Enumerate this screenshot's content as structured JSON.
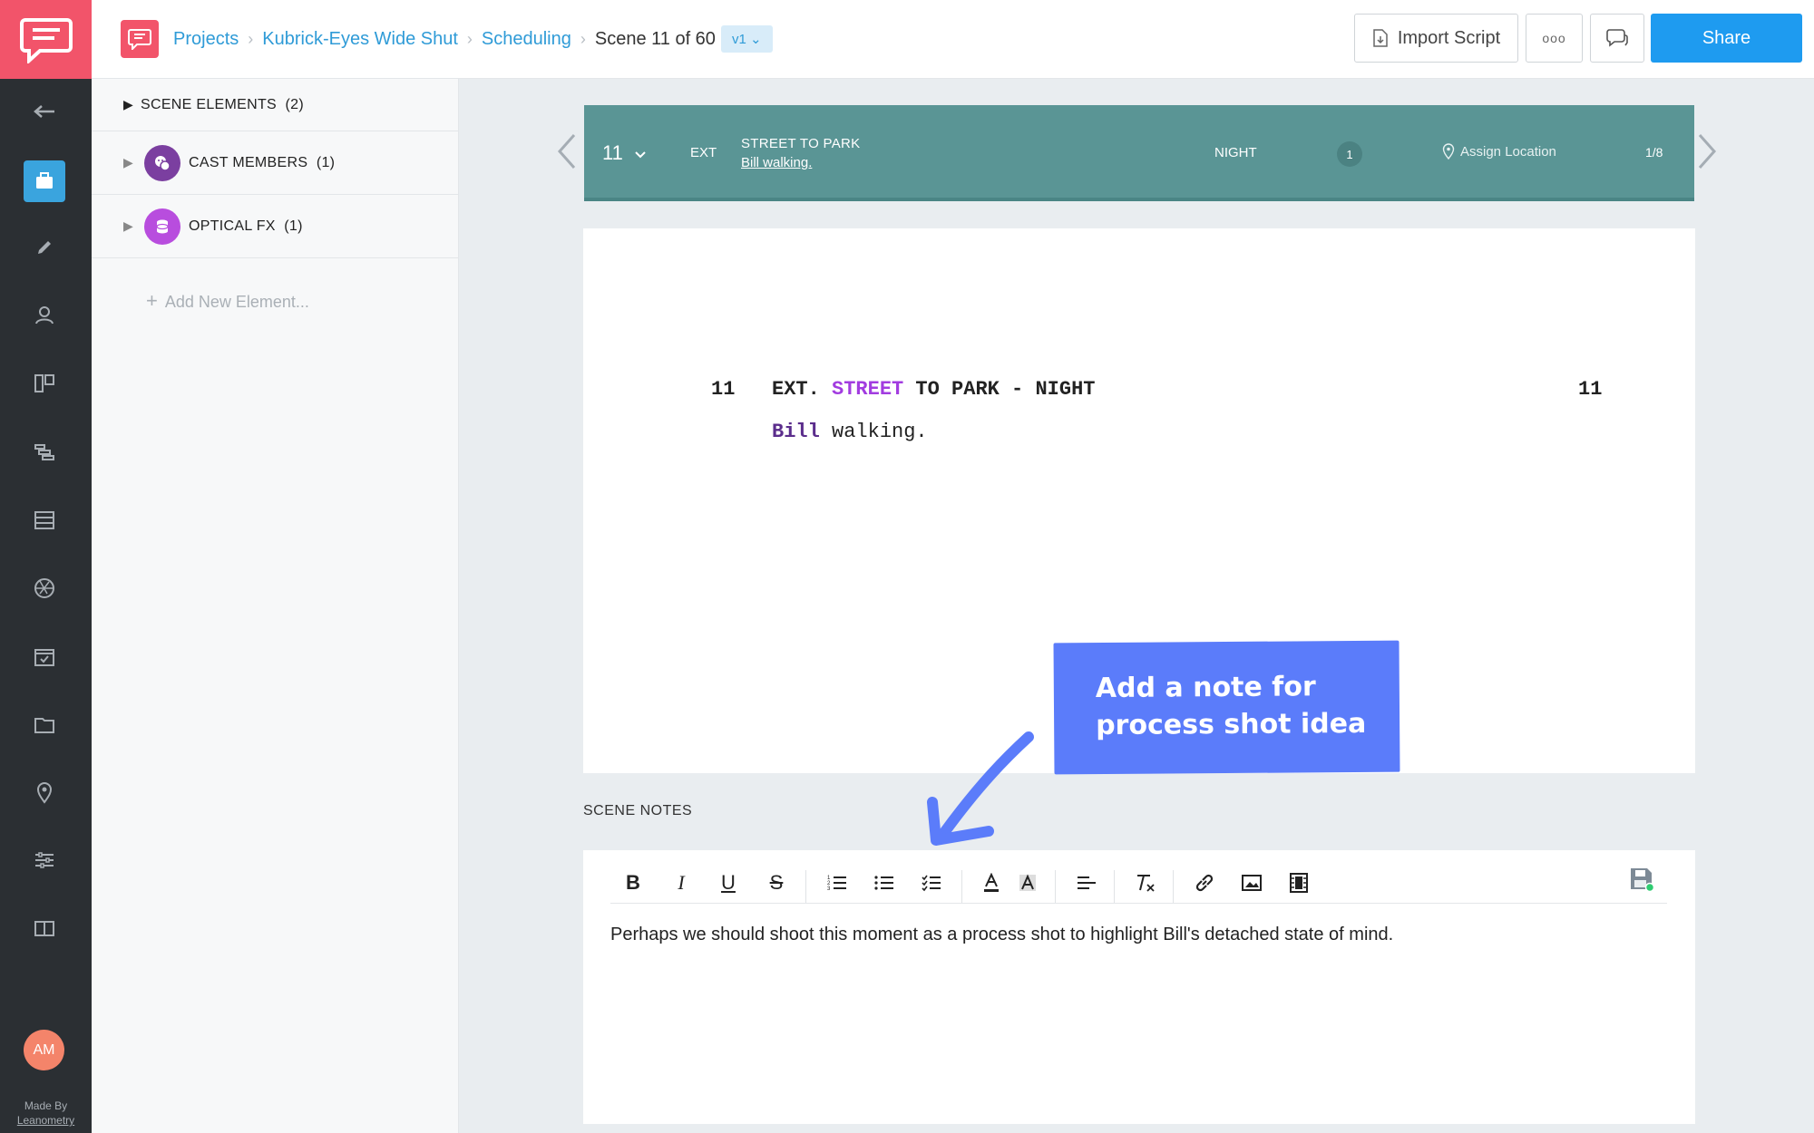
{
  "breadcrumbs": {
    "projects": "Projects",
    "project": "Kubrick-Eyes Wide Shut",
    "section": "Scheduling",
    "current": "Scene 11 of 60",
    "version": "v1"
  },
  "actions": {
    "import_label": "Import Script",
    "more_label": "ooo",
    "share_label": "Share"
  },
  "sidebar": {
    "avatar_initials": "AM",
    "made_by_line1": "Made By",
    "made_by_line2": "Leanometry"
  },
  "elements_panel": {
    "header_label": "SCENE ELEMENTS",
    "header_count": "(2)",
    "items": [
      {
        "label": "CAST MEMBERS",
        "count": "(1)"
      },
      {
        "label": "OPTICAL FX",
        "count": "(1)"
      }
    ],
    "add_label": "Add New Element..."
  },
  "scene_bar": {
    "number": "11",
    "int_ext": "EXT",
    "title": "STREET TO PARK",
    "description": "Bill walking.",
    "time": "NIGHT",
    "count": "1",
    "location": "Assign Location",
    "eighths": "1/8",
    "color": "#5a9595"
  },
  "script": {
    "scene_num_left": "11",
    "heading_prefix": "EXT. ",
    "heading_highlight": "STREET",
    "heading_suffix": " TO PARK - NIGHT",
    "scene_num_right": "11",
    "action_highlight": "Bill",
    "action_rest": " walking."
  },
  "callout": {
    "line1": "Add a note for",
    "line2": "process shot idea",
    "color": "#5b7cfa"
  },
  "notes": {
    "label": "SCENE NOTES",
    "text": "Perhaps we should shoot this moment as a process shot to highlight Bill's detached state of mind."
  },
  "toolbar": {
    "bold": "B",
    "italic": "I",
    "underline": "U",
    "strike": "S"
  },
  "colors": {
    "accent": "#1e9bf0",
    "brand": "#f2546a",
    "rail": "#2b2f33",
    "highlight_purple": "#a23ce0"
  }
}
